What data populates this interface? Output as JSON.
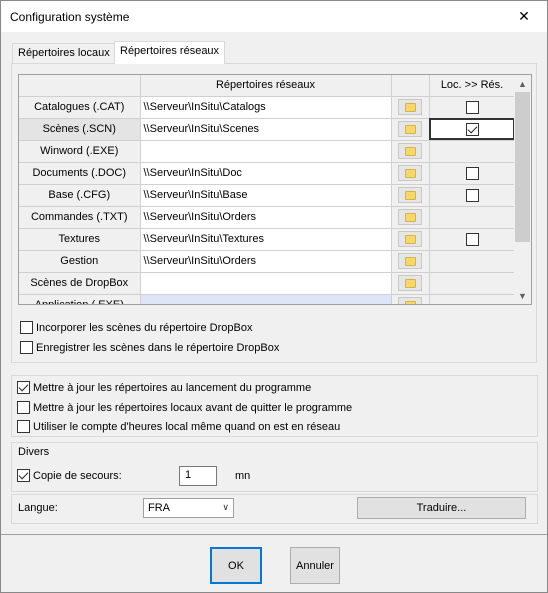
{
  "window": {
    "title": "Configuration système",
    "close_glyph": "✕"
  },
  "tabs": [
    {
      "label": "Répertoires locaux",
      "active": false
    },
    {
      "label": "Répertoires réseaux",
      "active": true
    }
  ],
  "grid": {
    "columns": {
      "path": "Répertoires réseaux",
      "loc_to_res": "Loc. >> Rés."
    },
    "rows": [
      {
        "label": "Catalogues (.CAT)",
        "path": "\\\\Serveur\\InSitu\\Catalogs",
        "has_check": true,
        "checked": false
      },
      {
        "label": "Scènes (.SCN)",
        "path": "\\\\Serveur\\InSitu\\Scenes",
        "has_check": true,
        "checked": true
      },
      {
        "label": "Winword (.EXE)",
        "path": "",
        "has_check": false,
        "checked": false
      },
      {
        "label": "Documents (.DOC)",
        "path": "\\\\Serveur\\InSitu\\Doc",
        "has_check": true,
        "checked": false
      },
      {
        "label": "Base (.CFG)",
        "path": "\\\\Serveur\\InSitu\\Base",
        "has_check": true,
        "checked": false
      },
      {
        "label": "Commandes (.TXT)",
        "path": "\\\\Serveur\\InSitu\\Orders",
        "has_check": false,
        "checked": false
      },
      {
        "label": "Textures",
        "path": "\\\\Serveur\\InSitu\\Textures",
        "has_check": true,
        "checked": false
      },
      {
        "label": "Gestion",
        "path": "\\\\Serveur\\InSitu\\Orders",
        "has_check": false,
        "checked": false
      },
      {
        "label": "Scènes de DropBox",
        "path": "",
        "has_check": false,
        "checked": false
      },
      {
        "label": "Application (.EXE)",
        "path": "",
        "has_check": false,
        "checked": false
      }
    ]
  },
  "dropbox": {
    "incorporer": {
      "label": "Incorporer les scènes du répertoire DropBox",
      "checked": false
    },
    "enregistrer": {
      "label": "Enregistrer les scènes dans le répertoire DropBox",
      "checked": false
    }
  },
  "options": {
    "maj_lancement": {
      "label": "Mettre à jour les répertoires au lancement du programme",
      "checked": true
    },
    "maj_quitter": {
      "label": "Mettre à jour les répertoires locaux avant de quitter le programme",
      "checked": false
    },
    "compte_heures": {
      "label": "Utiliser le compte d'heures local même quand on est en réseau",
      "checked": false
    }
  },
  "divers": {
    "title": "Divers",
    "copie_label": "Copie de secours:",
    "copie_checked": true,
    "copie_value": "1",
    "unit": "mn"
  },
  "langue": {
    "label": "Langue:",
    "selected": "FRA",
    "traduire": "Traduire..."
  },
  "footer": {
    "ok": "OK",
    "cancel": "Annuler"
  },
  "colors": {
    "accent": "#0078d7",
    "folder": "#f7d766",
    "editing_cell": "#dde6f8"
  }
}
